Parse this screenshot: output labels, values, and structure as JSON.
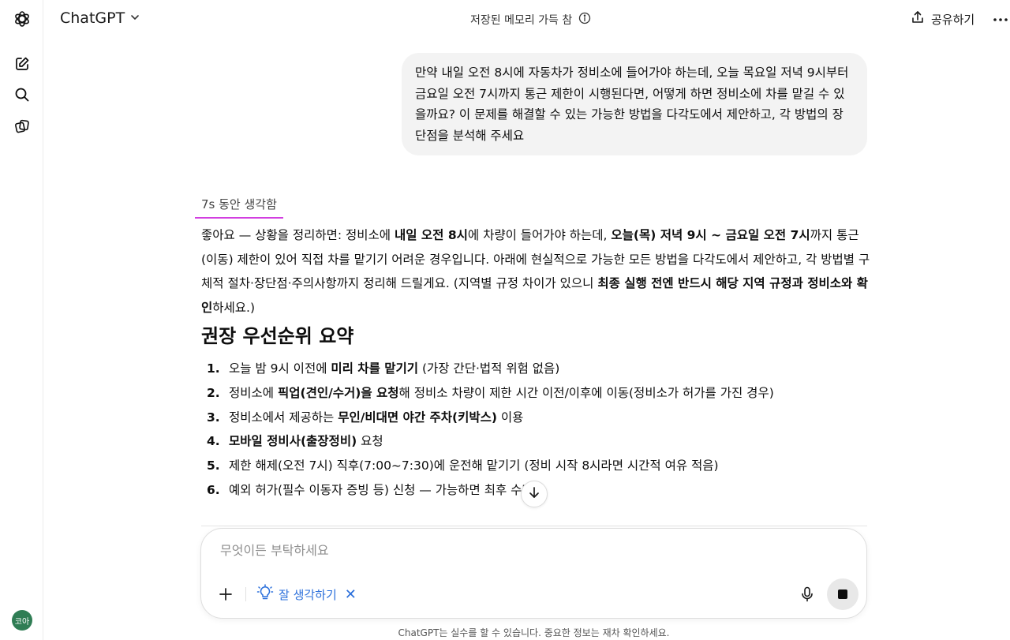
{
  "header": {
    "model_name": "ChatGPT",
    "memory_status": "저장된 메모리 가득 참",
    "share_label": "공유하기"
  },
  "sidebar": {
    "avatar_text": "코아"
  },
  "conversation": {
    "user_message": "만약 내일 오전 8시에 자동차가 정비소에 들어가야 하는데, 오늘 목요일 저녁 9시부터 금요일 오전 7시까지 통근 제한이 시행된다면, 어떻게 하면 정비소에 차를 맡길 수 있을까요? 이 문제를 해결할 수 있는 가능한 방법을 다각도에서 제안하고, 각 방법의 장단점을 분석해 주세요",
    "thought_label": "7s 동안 생각함",
    "answer_intro": [
      {
        "t": "좋아요 — 상황을 정리하면: 정비소에 ",
        "b": false
      },
      {
        "t": "내일 오전 8시",
        "b": true
      },
      {
        "t": "에 차량이 들어가야 하는데, ",
        "b": false
      },
      {
        "t": "오늘(목) 저녁 9시 ~ 금요일 오전 7시",
        "b": true
      },
      {
        "t": "까지 통근(이동) 제한이 있어 직접 차를 맡기기 어려운 경우입니다. 아래에 현실적으로 가능한 모든 방법을 다각도에서 제안하고, 각 방법별 구체적 절차·장단점·주의사항까지 정리해 드릴게요. (지역별 규정 차이가 있으니 ",
        "b": false
      },
      {
        "t": "최종 실행 전엔 반드시 해당 지역 규정과 정비소와 확인",
        "b": true
      },
      {
        "t": "하세요.)",
        "b": false
      }
    ],
    "section_title": "권장 우선순위 요약",
    "priority_items": [
      {
        "num": "1.",
        "parts": [
          {
            "t": "오늘 밤 9시 이전에 ",
            "b": false
          },
          {
            "t": "미리 차를 맡기기",
            "b": true
          },
          {
            "t": " (가장 간단·법적 위험 없음)",
            "b": false
          }
        ]
      },
      {
        "num": "2.",
        "parts": [
          {
            "t": "정비소에 ",
            "b": false
          },
          {
            "t": "픽업(견인/수거)을 요청",
            "b": true
          },
          {
            "t": "해 정비소 차량이 제한 시간 이전/이후에 이동(정비소가 허가를 가진 경우)",
            "b": false
          }
        ]
      },
      {
        "num": "3.",
        "parts": [
          {
            "t": "정비소에서 제공하는 ",
            "b": false
          },
          {
            "t": "무인/비대면 야간 주차(키박스)",
            "b": true
          },
          {
            "t": " 이용",
            "b": false
          }
        ]
      },
      {
        "num": "4.",
        "parts": [
          {
            "t": "모바일 정비사(출장정비)",
            "b": true
          },
          {
            "t": " 요청",
            "b": false
          }
        ]
      },
      {
        "num": "5.",
        "parts": [
          {
            "t": "제한 해제(오전 7시) 직후(7:00~7:30)에 운전해 맡기기 (정비 시작 8시라면 시간적 여유 적음)",
            "b": false
          }
        ]
      },
      {
        "num": "6.",
        "parts": [
          {
            "t": "예외 허가(필수 이동자 증빙 등) 신청 — 가능하면 최후 수단",
            "b": false
          }
        ]
      }
    ]
  },
  "composer": {
    "placeholder": "무엇이든 부탁하세요",
    "think_label": "잘 생각하기"
  },
  "footer": {
    "disclaimer": "ChatGPT는 실수를 할 수 있습니다. 중요한 정보는 재차 확인하세요."
  },
  "colors": {
    "accent": "#2a6fdb",
    "thought_underline": "#d23fe0",
    "bubble": "#f3f3f3"
  }
}
